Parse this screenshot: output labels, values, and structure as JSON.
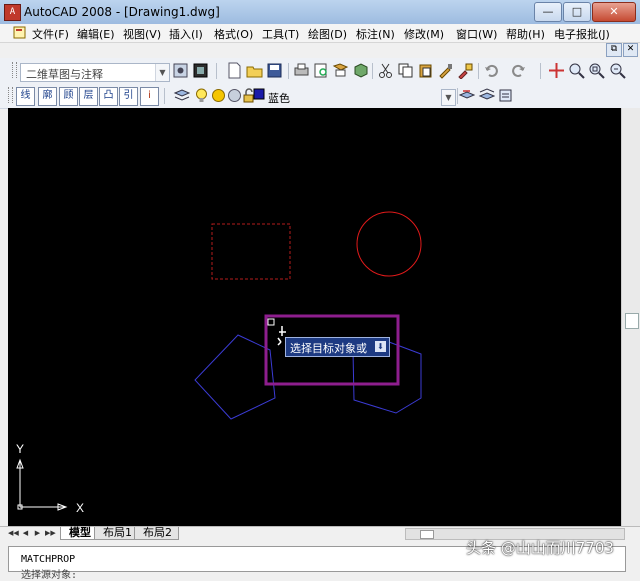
{
  "window": {
    "title": "AutoCAD 2008 - [Drawing1.dwg]",
    "app_icon_glyph": "A",
    "minimize": "—",
    "maximize": "□",
    "close": "✕"
  },
  "menu": {
    "items": [
      "文件(F)",
      "编辑(E)",
      "视图(V)",
      "插入(I)",
      "格式(O)",
      "工具(T)",
      "绘图(D)",
      "标注(N)",
      "修改(M)",
      "窗口(W)",
      "帮助(H)",
      "电子报批(J)"
    ]
  },
  "toolbar": {
    "workspace_select": "二维草图与注释",
    "layer_color_value": "蓝色",
    "row1_icons": [
      "workspace-settings-icon",
      "my-workspace-icon",
      "new-icon",
      "open-icon",
      "save-icon",
      "print-icon",
      "print-preview-icon",
      "publish-icon",
      "3d-dwf-icon",
      "cut-icon",
      "copy-icon",
      "paste-icon",
      "match-properties-icon",
      "block-editor-icon",
      "undo-icon",
      "redo-icon",
      "pan-icon",
      "zoom-realtime-icon",
      "zoom-window-icon",
      "zoom-previous-icon"
    ],
    "row2_text_buttons": [
      "线",
      "廓",
      "顾",
      "层",
      "凸",
      "引",
      "ⅰ"
    ]
  },
  "canvas": {
    "tooltip_text": "选择目标对象或",
    "tooltip_button": "⬇",
    "ucs_y_label": "Y",
    "ucs_x_label": "X",
    "colors": {
      "background": "#000000",
      "rectangle": "#b51b1b",
      "circle": "#e01a1a",
      "polygons": "#3b3bd4",
      "selection": "#8e1e8e",
      "ucs": "#ffffff"
    }
  },
  "tabs": {
    "nav": [
      "◀◀",
      "◀",
      "▶",
      "▶▶"
    ],
    "items": [
      "模型",
      "布局1",
      "布局2"
    ],
    "active": "模型"
  },
  "command_line": {
    "line1": "MATCHPROP",
    "line2": "选择源对象:"
  },
  "watermark": "头条 @山山而川7703"
}
